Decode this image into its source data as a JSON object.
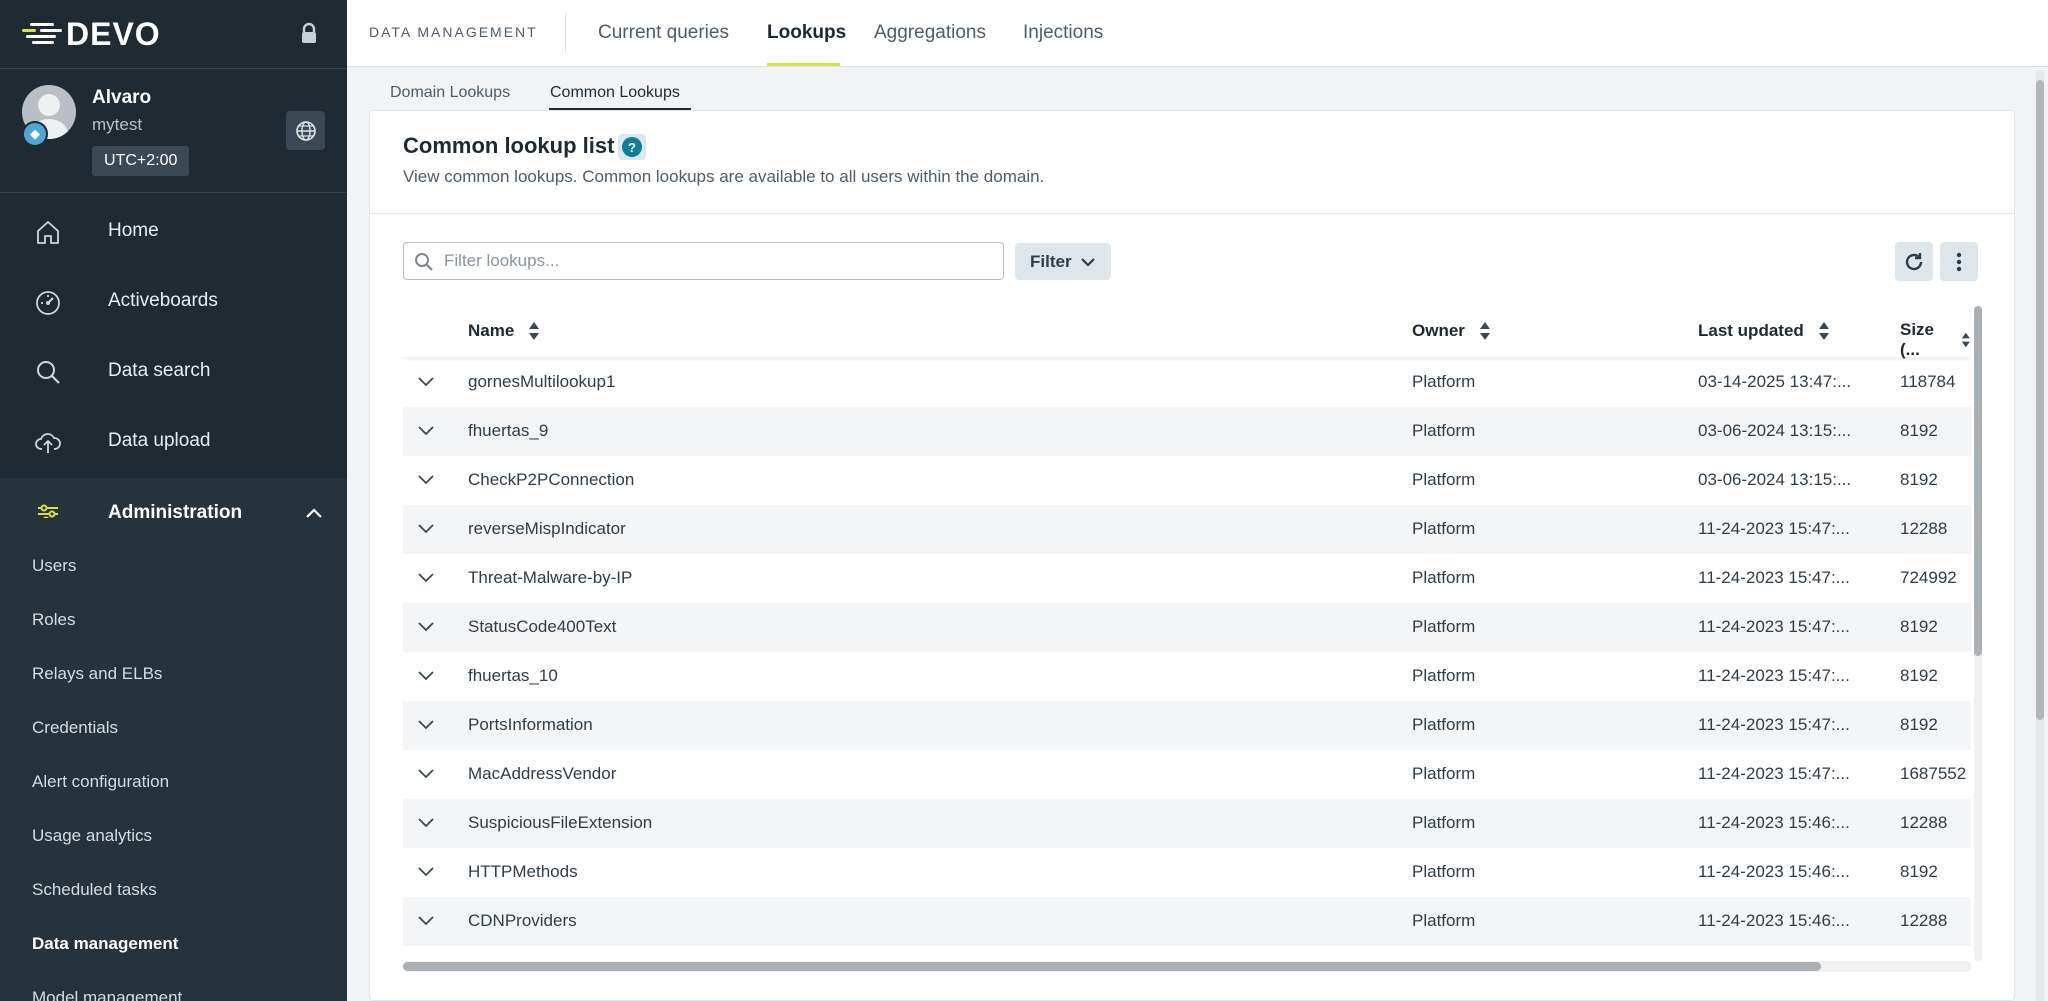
{
  "app": {
    "logo_text": "DEVO"
  },
  "user": {
    "name": "Alvaro",
    "domain": "mytest",
    "timezone": "UTC+2:00"
  },
  "nav": [
    {
      "label": "Home",
      "icon": "home-icon"
    },
    {
      "label": "Activeboards",
      "icon": "gauge-icon"
    },
    {
      "label": "Data search",
      "icon": "search-icon"
    },
    {
      "label": "Data upload",
      "icon": "cloud-upload-icon"
    },
    {
      "label": "Administration",
      "icon": "sliders-icon",
      "expanded": true
    }
  ],
  "admin_items": [
    "Users",
    "Roles",
    "Relays and ELBs",
    "Credentials",
    "Alert configuration",
    "Usage analytics",
    "Scheduled tasks",
    "Data management",
    "Model management"
  ],
  "admin_active": "Data management",
  "header": {
    "section": "DATA MANAGEMENT",
    "tabs": [
      "Current queries",
      "Lookups",
      "Aggregations",
      "Injections"
    ],
    "active_tab": "Lookups"
  },
  "subtabs": {
    "items": [
      "Domain Lookups",
      "Common Lookups"
    ],
    "active": "Common Lookups"
  },
  "card": {
    "title": "Common lookup list",
    "help": "?",
    "description": "View common lookups. Common lookups are available to all users within the domain."
  },
  "toolbar": {
    "search_placeholder": "Filter lookups...",
    "search_value": "",
    "filter_label": "Filter"
  },
  "table": {
    "columns": [
      "Name",
      "Owner",
      "Last updated",
      "Size (..."
    ],
    "rows": [
      {
        "name": "gornesMultilookup1",
        "owner": "Platform",
        "updated": "03-14-2025 13:47:...",
        "size": "118784"
      },
      {
        "name": "fhuertas_9",
        "owner": "Platform",
        "updated": "03-06-2024 13:15:...",
        "size": "8192"
      },
      {
        "name": "CheckP2PConnection",
        "owner": "Platform",
        "updated": "03-06-2024 13:15:...",
        "size": "8192"
      },
      {
        "name": "reverseMispIndicator",
        "owner": "Platform",
        "updated": "11-24-2023 15:47:...",
        "size": "12288"
      },
      {
        "name": "Threat-Malware-by-IP",
        "owner": "Platform",
        "updated": "11-24-2023 15:47:...",
        "size": "724992"
      },
      {
        "name": "StatusCode400Text",
        "owner": "Platform",
        "updated": "11-24-2023 15:47:...",
        "size": "8192"
      },
      {
        "name": "fhuertas_10",
        "owner": "Platform",
        "updated": "11-24-2023 15:47:...",
        "size": "8192"
      },
      {
        "name": "PortsInformation",
        "owner": "Platform",
        "updated": "11-24-2023 15:47:...",
        "size": "8192"
      },
      {
        "name": "MacAddressVendor",
        "owner": "Platform",
        "updated": "11-24-2023 15:47:...",
        "size": "1687552"
      },
      {
        "name": "SuspiciousFileExtension",
        "owner": "Platform",
        "updated": "11-24-2023 15:46:...",
        "size": "12288"
      },
      {
        "name": "HTTPMethods",
        "owner": "Platform",
        "updated": "11-24-2023 15:46:...",
        "size": "8192"
      },
      {
        "name": "CDNProviders",
        "owner": "Platform",
        "updated": "11-24-2023 15:46:...",
        "size": "12288"
      }
    ]
  },
  "colors": {
    "sidebar_bg": "#1f2a33",
    "accent": "#d6e24b",
    "help_icon": "#0f7e96"
  }
}
